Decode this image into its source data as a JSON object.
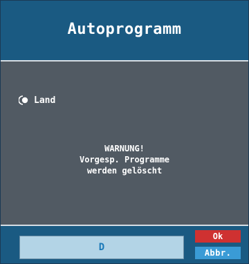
{
  "header": {
    "title": "Autoprogramm"
  },
  "options": {
    "land_label": "Land",
    "selected_icon": "radio-selected-icon"
  },
  "warning": {
    "line1": "WARNUNG!",
    "line2": "Vorgesp. Programme",
    "line3": "werden gelöscht"
  },
  "footer": {
    "input_value": "D",
    "ok_label": "Ok",
    "cancel_label": "Abbr."
  },
  "colors": {
    "header_bg": "#1a5a82",
    "content_bg": "#515a63",
    "ok_button": "#cf3131",
    "cancel_button": "#3a9bd6",
    "input_bg": "#b3d4e6"
  }
}
